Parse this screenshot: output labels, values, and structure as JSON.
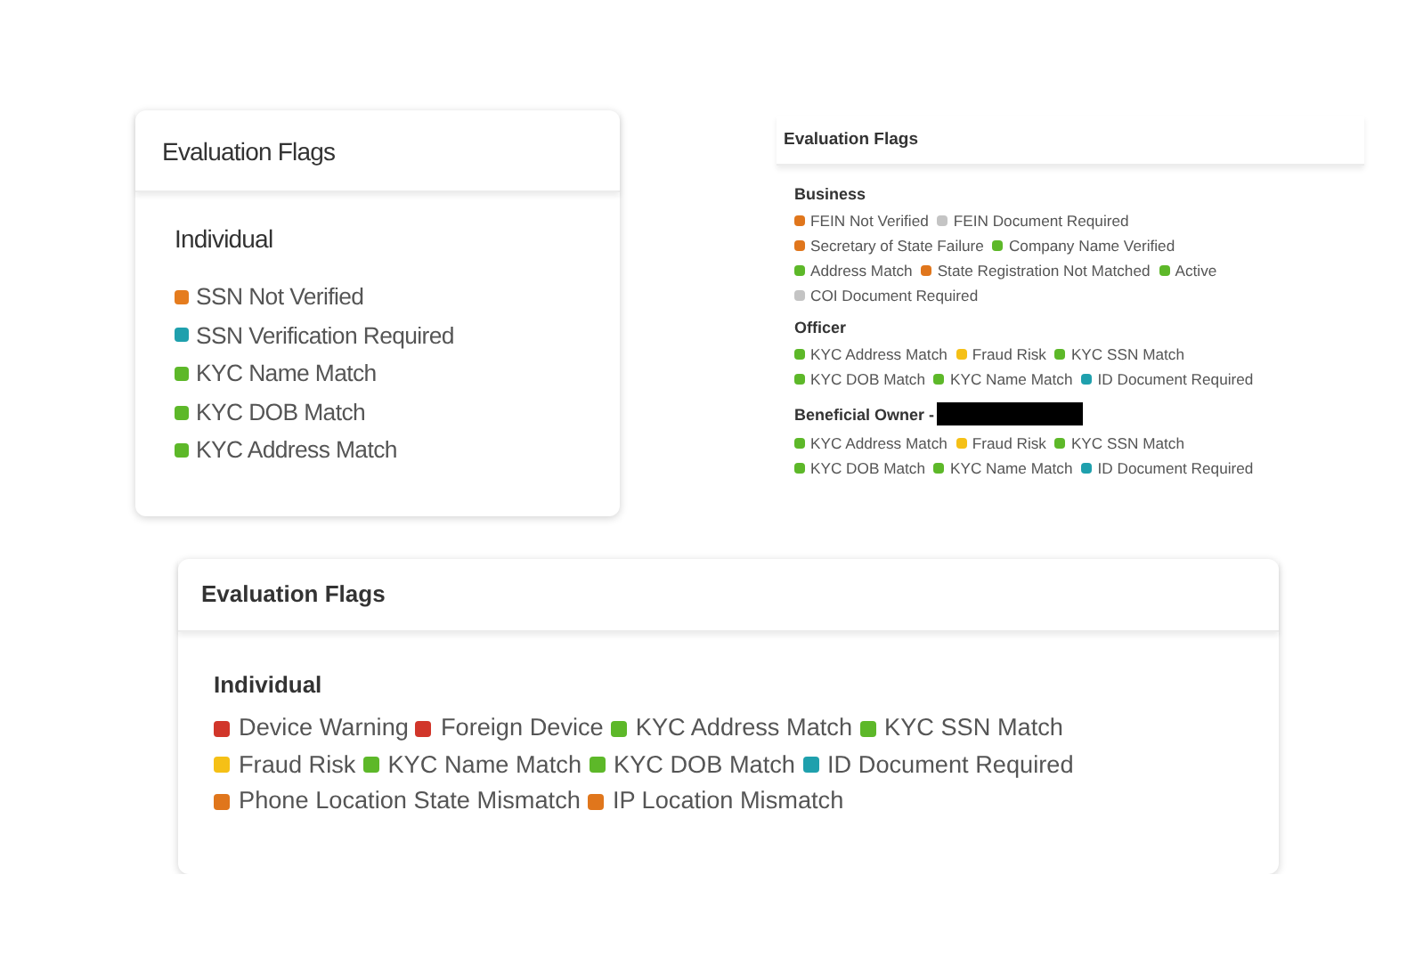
{
  "panels": [
    {
      "kind": "card",
      "title": "Evaluation Flags",
      "sections": [
        {
          "heading": "Individual",
          "lines": [
            [
              {
                "label": "SSN Not Verified",
                "color": "#e57c1e"
              }
            ],
            [
              {
                "label": "SSN Verification Required",
                "color": "#1fa0ad"
              }
            ],
            [
              {
                "label": "KYC Name Match",
                "color": "#5db829"
              }
            ],
            [
              {
                "label": "KYC DOB Match",
                "color": "#5db829"
              }
            ],
            [
              {
                "label": "KYC Address Match",
                "color": "#5db829"
              }
            ]
          ]
        }
      ]
    },
    {
      "kind": "flat",
      "title": "Evaluation Flags",
      "sections": [
        {
          "heading": "Business",
          "lines": [
            [
              {
                "label": "FEIN Not Verified",
                "color": "#e0761c"
              },
              {
                "label": "FEIN Document Required",
                "color": "#c4c4c4"
              }
            ],
            [
              {
                "label": "Secretary of State Failure",
                "color": "#e0761c"
              },
              {
                "label": "Company Name Verified",
                "color": "#5db829"
              }
            ],
            [
              {
                "label": "Address Match",
                "color": "#5db829"
              },
              {
                "label": "State Registration Not Matched",
                "color": "#e0761c"
              },
              {
                "label": "Active",
                "color": "#5db829"
              }
            ],
            [
              {
                "label": "COI Document Required",
                "color": "#c4c4c4"
              }
            ]
          ]
        },
        {
          "heading": "Officer",
          "lines": [
            [
              {
                "label": "KYC Address Match",
                "color": "#5db829"
              },
              {
                "label": "Fraud Risk",
                "color": "#f5c016"
              },
              {
                "label": "KYC SSN Match",
                "color": "#5db829"
              }
            ],
            [
              {
                "label": "KYC DOB Match",
                "color": "#5db829"
              },
              {
                "label": "KYC Name Match",
                "color": "#5db829"
              },
              {
                "label": "ID Document Required",
                "color": "#1fa0ad"
              }
            ]
          ]
        },
        {
          "heading": "Beneficial Owner -",
          "redacted": true,
          "lines": [
            [
              {
                "label": "KYC Address Match",
                "color": "#5db829"
              },
              {
                "label": "Fraud Risk",
                "color": "#f5c016"
              },
              {
                "label": "KYC SSN Match",
                "color": "#5db829"
              }
            ],
            [
              {
                "label": "KYC DOB Match",
                "color": "#5db829"
              },
              {
                "label": "KYC Name Match",
                "color": "#5db829"
              },
              {
                "label": "ID Document Required",
                "color": "#1fa0ad"
              }
            ]
          ]
        }
      ]
    },
    {
      "kind": "wide",
      "title": "Evaluation Flags",
      "sections": [
        {
          "heading": "Individual",
          "lines": [
            [
              {
                "label": "Device Warning",
                "color": "#d1362a"
              },
              {
                "label": "Foreign Device",
                "color": "#d1362a"
              },
              {
                "label": "KYC Address Match",
                "color": "#5db829"
              },
              {
                "label": "KYC SSN Match",
                "color": "#5db829"
              }
            ],
            [
              {
                "label": "Fraud Risk",
                "color": "#f5c016"
              },
              {
                "label": "KYC Name Match",
                "color": "#5db829"
              },
              {
                "label": "KYC DOB Match",
                "color": "#5db829"
              },
              {
                "label": "ID Document Required",
                "color": "#1fa0ad"
              }
            ],
            [
              {
                "label": "Phone Location State Mismatch",
                "color": "#e0761c"
              },
              {
                "label": "IP Location Mismatch",
                "color": "#e0761c"
              }
            ]
          ]
        }
      ]
    }
  ]
}
